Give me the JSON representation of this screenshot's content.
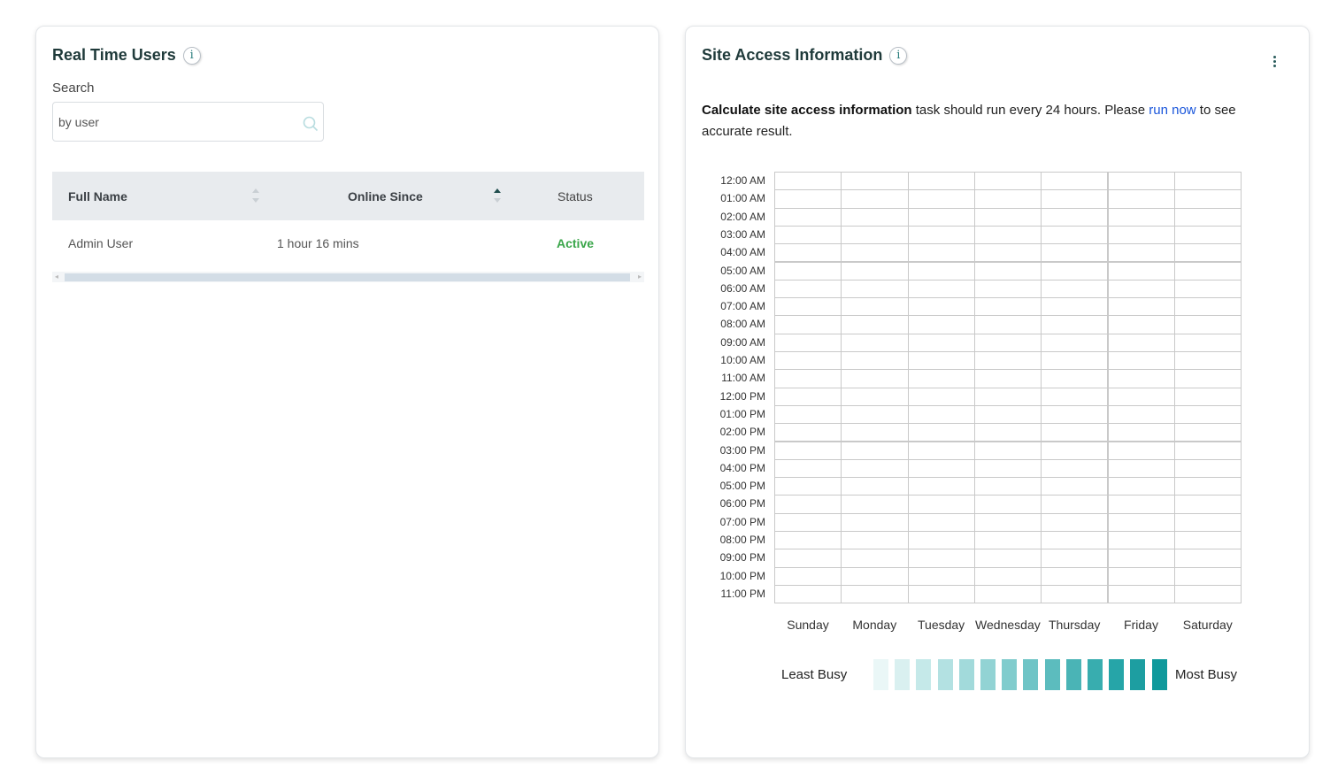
{
  "users_panel": {
    "title": "Real Time Users",
    "search_label": "Search",
    "search_placeholder": "by user",
    "columns": {
      "full_name": "Full Name",
      "online_since": "Online Since",
      "status": "Status"
    },
    "rows": [
      {
        "full_name": "Admin User",
        "online_since": "1 hour 16 mins",
        "status": "Active"
      }
    ]
  },
  "access_panel": {
    "title": "Site Access Information",
    "notice": {
      "bold": "Calculate site access information",
      "text1": " task should run every 24 hours. Please ",
      "link": "run now",
      "text2": " to see accurate result."
    },
    "hours": [
      "12:00 AM",
      "01:00 AM",
      "02:00 AM",
      "03:00 AM",
      "04:00 AM",
      "05:00 AM",
      "06:00 AM",
      "07:00 AM",
      "08:00 AM",
      "09:00 AM",
      "10:00 AM",
      "11:00 AM",
      "12:00 PM",
      "01:00 PM",
      "02:00 PM",
      "03:00 PM",
      "04:00 PM",
      "05:00 PM",
      "06:00 PM",
      "07:00 PM",
      "08:00 PM",
      "09:00 PM",
      "10:00 PM",
      "11:00 PM"
    ],
    "days": [
      "Sunday",
      "Monday",
      "Tuesday",
      "Wednesday",
      "Thursday",
      "Friday",
      "Saturday"
    ],
    "legend": {
      "least": "Least Busy",
      "most": "Most Busy",
      "colors": [
        "#eaf7f7",
        "#d9f0f0",
        "#c5e9e9",
        "#b3e1e2",
        "#a2dadb",
        "#92d3d4",
        "#80cccd",
        "#6ec4c6",
        "#5cbcbe",
        "#4ab4b6",
        "#38adaf",
        "#26a5a8",
        "#1d9ea1",
        "#0f999c"
      ]
    }
  }
}
